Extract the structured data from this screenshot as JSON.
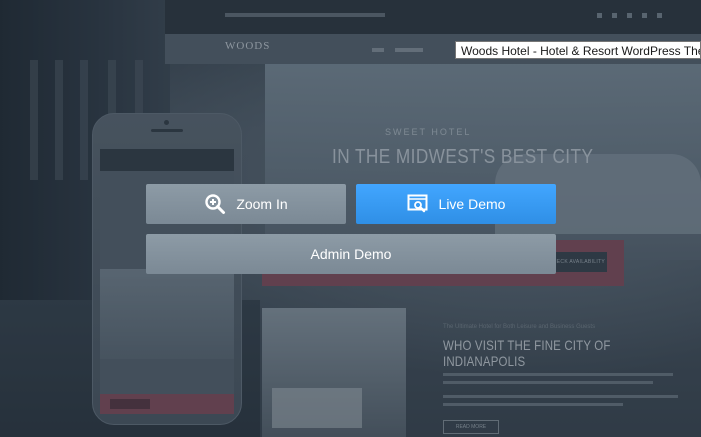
{
  "tooltip": {
    "text": "Woods Hotel - Hotel & Resort WordPress The"
  },
  "preview": {
    "logo": "WOODS",
    "hero_kicker": "SWEET HOTEL",
    "hero_title": "IN THE MIDWEST'S BEST CITY",
    "availability_button": "CHECK AVAILABILITY",
    "section_kicker": "The Ultimate Hotel for Both Leisure and Business Guests",
    "section_title": "WHO VISIT THE FINE CITY OF INDIANAPOLIS",
    "read_more": "READ MORE"
  },
  "actions": {
    "zoom_label": "Zoom In",
    "live_label": "Live Demo",
    "admin_label": "Admin Demo"
  },
  "icons": {
    "zoom": "zoom-in-icon",
    "live": "live-demo-icon"
  },
  "colors": {
    "live_button": "#3399f3",
    "neutral_button": "#8494a0",
    "accent_pink": "#8a4d5b"
  }
}
